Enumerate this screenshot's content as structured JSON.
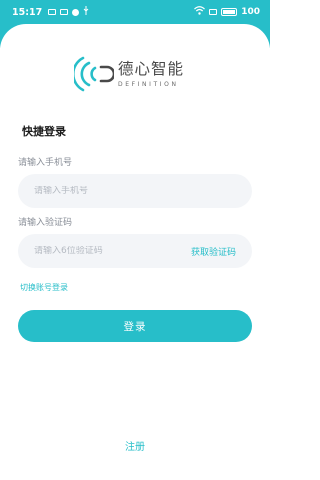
{
  "status_bar": {
    "time": "15:17",
    "battery": "100",
    "icons": [
      "mail-icon",
      "mail-icon",
      "notification-badge-icon",
      "usb-icon",
      "wifi-icon",
      "screen-icon",
      "battery-icon"
    ]
  },
  "logo": {
    "name_cn": "德心智能",
    "name_en": "DEFINITION"
  },
  "form": {
    "title": "快捷登录",
    "phone": {
      "label": "请输入手机号",
      "placeholder": "请输入手机号",
      "value": ""
    },
    "code": {
      "label": "请输入验证码",
      "placeholder": "请输入6位验证码",
      "value": "",
      "get_code": "获取验证码"
    },
    "switch_link": "切换账号登录",
    "login_button": "登录",
    "register_link": "注册"
  },
  "colors": {
    "accent": "#27bec9",
    "input_bg": "#f3f5f8",
    "label_text": "#8a8f98",
    "logo_text": "#4a4a4a"
  }
}
